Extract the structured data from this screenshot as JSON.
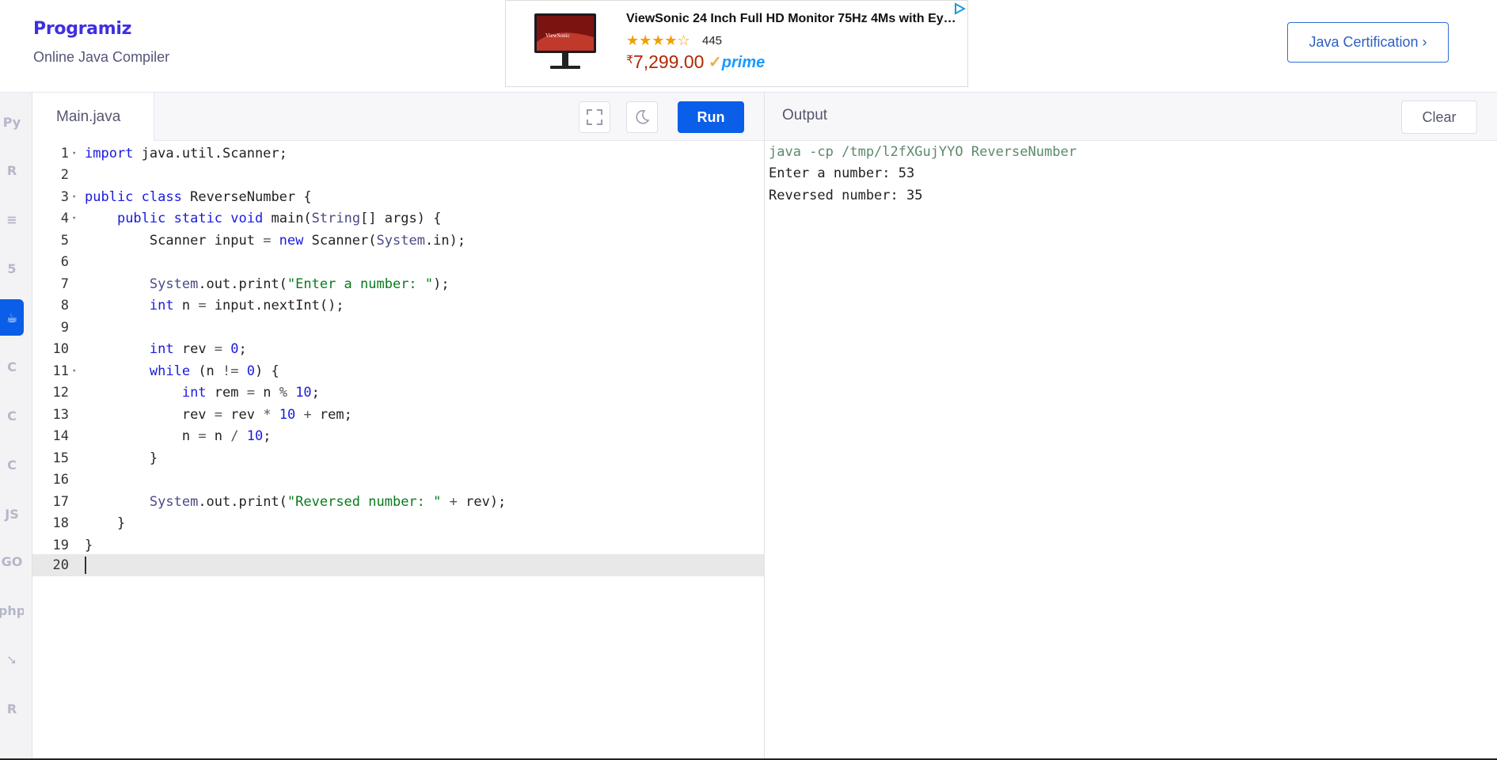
{
  "header": {
    "logo_text": "Programiz",
    "subtitle": "Online Java Compiler",
    "cta_label": "Java Certification ›"
  },
  "ad": {
    "title": "ViewSonic 24 Inch Full HD Monitor 75Hz 4Ms with Ey…",
    "rating_stars": "★★★★☆",
    "rating": 4,
    "reviews": "445",
    "currency": "₹",
    "price": "7,299.00",
    "prime_label": "prime",
    "prime_check": "✓",
    "brand_on_image": "ViewSonic"
  },
  "rail": {
    "items": [
      {
        "name": "python-icon",
        "glyph": "Py"
      },
      {
        "name": "r-icon",
        "glyph": "R"
      },
      {
        "name": "sql-icon",
        "glyph": "≡"
      },
      {
        "name": "html-icon",
        "glyph": "5"
      },
      {
        "name": "java-icon",
        "glyph": "☕",
        "active": true
      },
      {
        "name": "c-icon",
        "glyph": "C"
      },
      {
        "name": "cpp-icon",
        "glyph": "C"
      },
      {
        "name": "csharp-icon",
        "glyph": "C"
      },
      {
        "name": "js-icon",
        "glyph": "JS"
      },
      {
        "name": "go-icon",
        "glyph": "GO"
      },
      {
        "name": "php-icon",
        "glyph": "php"
      },
      {
        "name": "swift-icon",
        "glyph": "➘"
      },
      {
        "name": "rust-icon",
        "glyph": "R"
      }
    ]
  },
  "editor": {
    "file_tab": "Main.java",
    "run_label": "Run",
    "lines": [
      {
        "n": "1",
        "fold": true
      },
      {
        "n": "2"
      },
      {
        "n": "3",
        "fold": true
      },
      {
        "n": "4",
        "fold": true
      },
      {
        "n": "5"
      },
      {
        "n": "6"
      },
      {
        "n": "7"
      },
      {
        "n": "8"
      },
      {
        "n": "9"
      },
      {
        "n": "10"
      },
      {
        "n": "11",
        "fold": true
      },
      {
        "n": "12"
      },
      {
        "n": "13"
      },
      {
        "n": "14"
      },
      {
        "n": "15"
      },
      {
        "n": "16"
      },
      {
        "n": "17"
      },
      {
        "n": "18"
      },
      {
        "n": "19"
      },
      {
        "n": "20",
        "current": true
      }
    ],
    "tokens": {
      "l1_kw": "import",
      "l1_rest": " java.util.Scanner;",
      "l3_kw1": "public",
      "l3_kw2": "class",
      "l3_rest": " ReverseNumber {",
      "l4_kw1": "public",
      "l4_kw2": "static",
      "l4_kw3": "void",
      "l4_a": " main(",
      "l4_ty": "String",
      "l4_b": "[] args) {",
      "l5_a": "Scanner input ",
      "l5_op": "=",
      "l5_kw": " new",
      "l5_b": " Scanner(",
      "l5_ty": "System",
      "l5_c": ".in);",
      "l7_ty": "System",
      "l7_a": ".out.print(",
      "l7_st": "\"Enter a number: \"",
      "l7_b": ");",
      "l8_kw": "int",
      "l8_a": " n ",
      "l8_op": "=",
      "l8_b": " input.nextInt();",
      "l10_kw": "int",
      "l10_a": " rev ",
      "l10_op": "=",
      "l10_nu": " 0",
      "l10_b": ";",
      "l11_kw": "while",
      "l11_a": " (n ",
      "l11_op": "!=",
      "l11_nu": " 0",
      "l11_b": ") {",
      "l12_kw": "int",
      "l12_a": " rem ",
      "l12_op1": "=",
      "l12_b": " n ",
      "l12_op2": "%",
      "l12_nu": " 10",
      "l12_c": ";",
      "l13_a": "rev ",
      "l13_op1": "=",
      "l13_b": " rev ",
      "l13_op2": "*",
      "l13_nu": " 10",
      "l13_c": " ",
      "l13_op3": "+",
      "l13_d": " rem;",
      "l14_a": "n ",
      "l14_op1": "=",
      "l14_b": " n ",
      "l14_op2": "/",
      "l14_nu": " 10",
      "l14_c": ";",
      "l15": "}",
      "l17_ty": "System",
      "l17_a": ".out.print(",
      "l17_st": "\"Reversed number: \"",
      "l17_b": " ",
      "l17_op": "+",
      "l17_c": " rev);",
      "l18": "}",
      "l19": "}"
    }
  },
  "output": {
    "title": "Output",
    "clear_label": "Clear",
    "lines": [
      "java -cp /tmp/l2fXGujYYO ReverseNumber",
      "Enter a number: 53",
      "Reversed number: 35"
    ]
  },
  "colors": {
    "accent": "#0a5ee8",
    "keyword": "#1a1ae0",
    "string": "#0a7a1e",
    "price": "#b12704"
  }
}
